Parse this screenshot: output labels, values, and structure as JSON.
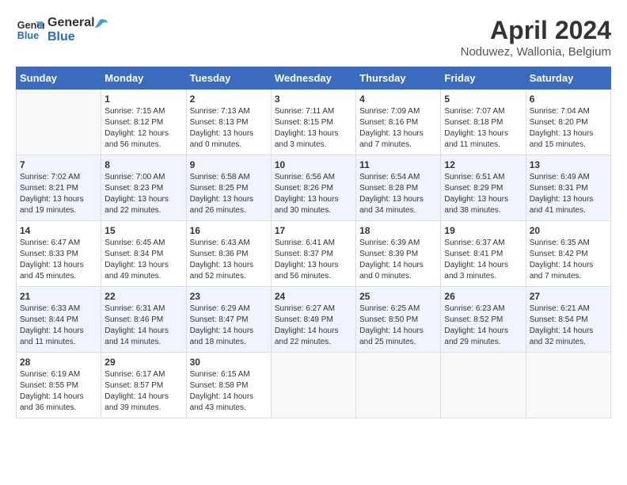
{
  "header": {
    "logo_line1": "General",
    "logo_line2": "Blue",
    "title": "April 2024",
    "subtitle": "Noduwez, Wallonia, Belgium"
  },
  "calendar": {
    "headers": [
      "Sunday",
      "Monday",
      "Tuesday",
      "Wednesday",
      "Thursday",
      "Friday",
      "Saturday"
    ],
    "rows": [
      [
        {
          "day": "",
          "content": ""
        },
        {
          "day": "1",
          "content": "Sunrise: 7:15 AM\nSunset: 8:12 PM\nDaylight: 12 hours and 56 minutes."
        },
        {
          "day": "2",
          "content": "Sunrise: 7:13 AM\nSunset: 8:13 PM\nDaylight: 13 hours and 0 minutes."
        },
        {
          "day": "3",
          "content": "Sunrise: 7:11 AM\nSunset: 8:15 PM\nDaylight: 13 hours and 3 minutes."
        },
        {
          "day": "4",
          "content": "Sunrise: 7:09 AM\nSunset: 8:16 PM\nDaylight: 13 hours and 7 minutes."
        },
        {
          "day": "5",
          "content": "Sunrise: 7:07 AM\nSunset: 8:18 PM\nDaylight: 13 hours and 11 minutes."
        },
        {
          "day": "6",
          "content": "Sunrise: 7:04 AM\nSunset: 8:20 PM\nDaylight: 13 hours and 15 minutes."
        }
      ],
      [
        {
          "day": "7",
          "content": "Sunrise: 7:02 AM\nSunset: 8:21 PM\nDaylight: 13 hours and 19 minutes."
        },
        {
          "day": "8",
          "content": "Sunrise: 7:00 AM\nSunset: 8:23 PM\nDaylight: 13 hours and 22 minutes."
        },
        {
          "day": "9",
          "content": "Sunrise: 6:58 AM\nSunset: 8:25 PM\nDaylight: 13 hours and 26 minutes."
        },
        {
          "day": "10",
          "content": "Sunrise: 6:56 AM\nSunset: 8:26 PM\nDaylight: 13 hours and 30 minutes."
        },
        {
          "day": "11",
          "content": "Sunrise: 6:54 AM\nSunset: 8:28 PM\nDaylight: 13 hours and 34 minutes."
        },
        {
          "day": "12",
          "content": "Sunrise: 6:51 AM\nSunset: 8:29 PM\nDaylight: 13 hours and 38 minutes."
        },
        {
          "day": "13",
          "content": "Sunrise: 6:49 AM\nSunset: 8:31 PM\nDaylight: 13 hours and 41 minutes."
        }
      ],
      [
        {
          "day": "14",
          "content": "Sunrise: 6:47 AM\nSunset: 8:33 PM\nDaylight: 13 hours and 45 minutes."
        },
        {
          "day": "15",
          "content": "Sunrise: 6:45 AM\nSunset: 8:34 PM\nDaylight: 13 hours and 49 minutes."
        },
        {
          "day": "16",
          "content": "Sunrise: 6:43 AM\nSunset: 8:36 PM\nDaylight: 13 hours and 52 minutes."
        },
        {
          "day": "17",
          "content": "Sunrise: 6:41 AM\nSunset: 8:37 PM\nDaylight: 13 hours and 56 minutes."
        },
        {
          "day": "18",
          "content": "Sunrise: 6:39 AM\nSunset: 8:39 PM\nDaylight: 14 hours and 0 minutes."
        },
        {
          "day": "19",
          "content": "Sunrise: 6:37 AM\nSunset: 8:41 PM\nDaylight: 14 hours and 3 minutes."
        },
        {
          "day": "20",
          "content": "Sunrise: 6:35 AM\nSunset: 8:42 PM\nDaylight: 14 hours and 7 minutes."
        }
      ],
      [
        {
          "day": "21",
          "content": "Sunrise: 6:33 AM\nSunset: 8:44 PM\nDaylight: 14 hours and 11 minutes."
        },
        {
          "day": "22",
          "content": "Sunrise: 6:31 AM\nSunset: 8:46 PM\nDaylight: 14 hours and 14 minutes."
        },
        {
          "day": "23",
          "content": "Sunrise: 6:29 AM\nSunset: 8:47 PM\nDaylight: 14 hours and 18 minutes."
        },
        {
          "day": "24",
          "content": "Sunrise: 6:27 AM\nSunset: 8:49 PM\nDaylight: 14 hours and 22 minutes."
        },
        {
          "day": "25",
          "content": "Sunrise: 6:25 AM\nSunset: 8:50 PM\nDaylight: 14 hours and 25 minutes."
        },
        {
          "day": "26",
          "content": "Sunrise: 6:23 AM\nSunset: 8:52 PM\nDaylight: 14 hours and 29 minutes."
        },
        {
          "day": "27",
          "content": "Sunrise: 6:21 AM\nSunset: 8:54 PM\nDaylight: 14 hours and 32 minutes."
        }
      ],
      [
        {
          "day": "28",
          "content": "Sunrise: 6:19 AM\nSunset: 8:55 PM\nDaylight: 14 hours and 36 minutes."
        },
        {
          "day": "29",
          "content": "Sunrise: 6:17 AM\nSunset: 8:57 PM\nDaylight: 14 hours and 39 minutes."
        },
        {
          "day": "30",
          "content": "Sunrise: 6:15 AM\nSunset: 8:58 PM\nDaylight: 14 hours and 43 minutes."
        },
        {
          "day": "",
          "content": ""
        },
        {
          "day": "",
          "content": ""
        },
        {
          "day": "",
          "content": ""
        },
        {
          "day": "",
          "content": ""
        }
      ]
    ]
  }
}
